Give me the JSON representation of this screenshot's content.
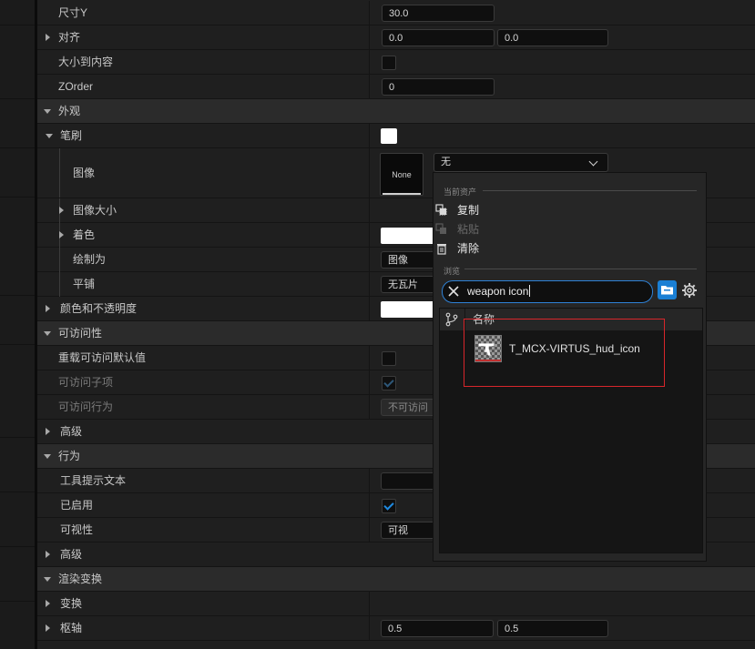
{
  "rows": {
    "size_y": {
      "label": "尺寸Y",
      "value": "30.0"
    },
    "alignment": {
      "label": "对齐",
      "x": "0.0",
      "y": "0.0"
    },
    "size_to_content": {
      "label": "大小到内容",
      "checked": false
    },
    "zorder": {
      "label": "ZOrder",
      "value": "0"
    },
    "appearance": {
      "label": "外观"
    },
    "brush": {
      "label": "笔刷"
    },
    "image": {
      "label": "图像",
      "thumb_text": "None",
      "dropdown_value": "无"
    },
    "image_size": {
      "label": "图像大小"
    },
    "tint": {
      "label": "着色"
    },
    "draw_as": {
      "label": "绘制为",
      "value": "图像"
    },
    "tiling": {
      "label": "平铺",
      "value": "无瓦片"
    },
    "color_opacity": {
      "label": "颜色和不透明度"
    },
    "accessibility": {
      "label": "可访问性"
    },
    "override_access": {
      "label": "重载可访问默认值",
      "checked": false
    },
    "access_children": {
      "label": "可访问子项",
      "checked": true
    },
    "access_behavior": {
      "label": "可访问行为",
      "value": "不可访问"
    },
    "advanced1": {
      "label": "高级"
    },
    "behavior": {
      "label": "行为"
    },
    "tooltip": {
      "label": "工具提示文本",
      "value": ""
    },
    "enabled": {
      "label": "已启用",
      "checked": true
    },
    "visibility": {
      "label": "可视性",
      "value": "可视"
    },
    "advanced2": {
      "label": "高级"
    },
    "render_transform": {
      "label": "渲染变换"
    },
    "transform": {
      "label": "变换"
    },
    "pivot": {
      "label": "枢轴",
      "x": "0.5",
      "y": "0.5"
    }
  },
  "popup": {
    "current_asset_heading": "当前资产",
    "copy": "复制",
    "paste": "粘贴",
    "clear": "清除",
    "browse_heading": "浏览",
    "search_value": "weapon icon",
    "column_name": "名称",
    "asset_name": "T_MCX-VIRTUS_hud_icon"
  },
  "colors": {
    "accent": "#1f8ae0",
    "highlight_box": "#d8262b",
    "swatch": "#ffffff"
  }
}
